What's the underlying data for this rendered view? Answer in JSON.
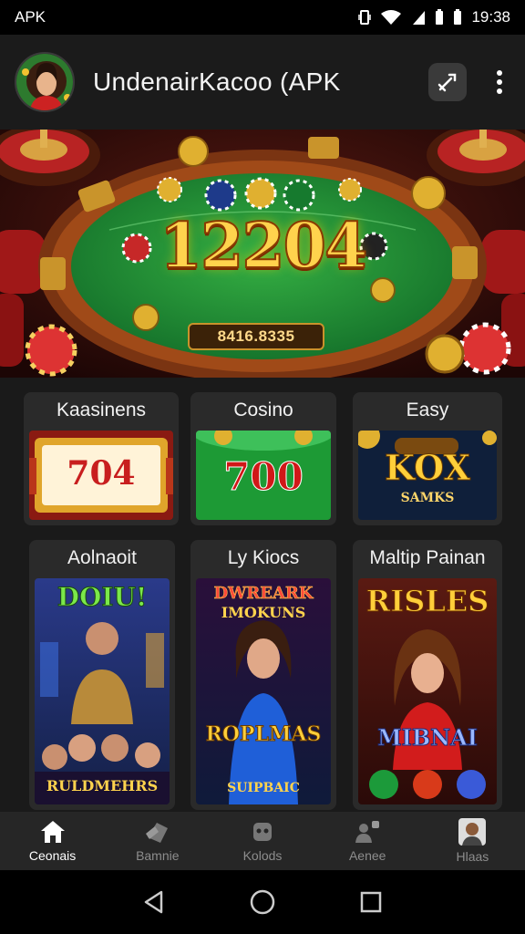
{
  "status_bar": {
    "left_text": "APK",
    "time": "19:38"
  },
  "app_bar": {
    "title": "UndenairKacoo  (APK"
  },
  "banner": {
    "jackpot": "12204",
    "plate": "8416.8335"
  },
  "cards": [
    {
      "label": "Kaasinens",
      "art_text": "704"
    },
    {
      "label": "Cosino",
      "art_text": "700"
    },
    {
      "label": "Easy",
      "art_text": "KOX",
      "art_sub": "SAMKS"
    },
    {
      "label": "Aolnaoit",
      "art_text": "DOIU!",
      "art_sub": "RULDMEHRS"
    },
    {
      "label": "Ly Kiocs",
      "art_text": "DWREARK",
      "art_sub": "IMOKUNS",
      "art_text2": "ROPLMAS",
      "art_sub2": "SUIPBAIC"
    },
    {
      "label": "Maltip Painan",
      "art_text": "RISLES",
      "art_sub": "MIBNAI"
    }
  ],
  "bottom_nav": [
    {
      "label": "Ceonais",
      "icon": "home-icon",
      "active": true
    },
    {
      "label": "Bamnie",
      "icon": "cards-icon",
      "active": false
    },
    {
      "label": "Kolods",
      "icon": "robot-icon",
      "active": false
    },
    {
      "label": "Aenee",
      "icon": "people-icon",
      "active": false
    },
    {
      "label": "Hlaas",
      "icon": "profile-avatar",
      "active": false
    }
  ],
  "colors": {
    "accent_gold": "#ffd34d",
    "felt_green": "#1f8a2e",
    "app_bar": "#1b1b1b"
  }
}
